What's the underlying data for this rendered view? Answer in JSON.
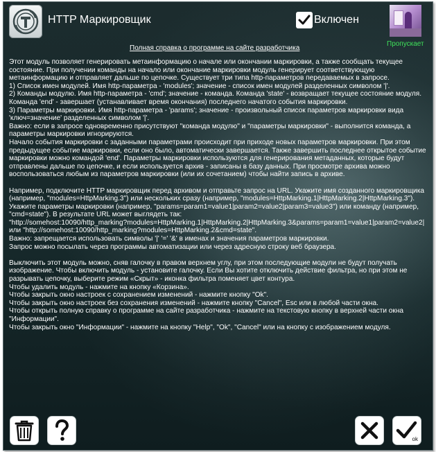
{
  "header": {
    "title": "HTTP Маркировщик",
    "enabled_label": "Включен",
    "enabled": true,
    "status": "Пропускает",
    "status_color": "#3fe05a",
    "help_link": "Полная справка о программе на сайте разработчика"
  },
  "body": {
    "paragraphs": [
      "Этот модуль позволяет генерировать метаинформацию о начале или окончании маркировки, а также сообщать текущее состояние. При получении команды на начало или окончание маркировки модуль генерирует соответствующую метаинформацию и отправляет дальше по цепочке. Существует три типа http-параметров передаваемых в запросе.\n1) Список имен модулей. Имя http-параметра - 'modules'; значение - список имен модулей разделенных символом '|'.\n2) Команды модулю. Имя http-параметра - 'cmd'; значение - команда. Команда 'state' - возвращает текущее состояние модуля. Команда 'end' - завершает (устанавливает время окончания) последнего начатого события маркировки.\n3) Параметры маркировки. Имя http-параметра - 'params'; значение - произвольный список параметров маркировки вида 'ключ=значение' разделенных символом '|'.\nВажно: если в запросе одновременно присутствуют \"команда модулю\" и \"параметры маркировки\" - выполнится команда, а параметры маркировки игнорируются.\nНачало события маркировки с заданными параметрами происходит при приходе новых параметров маркировки. При этом предыдущее событие маркировки, если оно было, автоматически завершается. Также завершить последнее открытое событие маркировки можно командой 'end'. Параметры маркировки используются для генерирования метаданных, которые будут отправлены дальше по цепочке, и если используется архив - записаны в базу данных. При просмотре архива можно воспользоваться любым из параметров маркировки (или их сочетанием) чтобы найти запись в архиве.",
      "Например, подключите HTTP маркировщик перед архивом и отправьте запрос на URL. Укажите имя созданного маркировщика (например, \"modules=HttpMarking.3\") или нескольких сразу (например, \"modules=HttpMarking.1|HttpMarking.2|HttpMarking.3\"). Укажите параметры маркировки (например, \"params=param1=value1|param2=value2|param3=value3\") или команду (например, \"cmd=state\"). В результате URL может выглядеть так:\n\"http://somehost:10090/http_marking?modules=HttpMarking.1|HttpMarking.2|HttpMarking.3&params=param1=value1|param2=value2| или \"http://somehost:10090/http_marking?modules=HttpMarking.2&cmd=state\".\nВажно: запрещается использовать символы '|' '=' '&' в именах и значения параметров маркировки.\nЗапрос можно посылать через программы автоматизации или через адресную строку веб браузера.",
      "Выключить этот модуль можно, сняв галочку в правом верхнем углу, при этом последующие модули не будут получать изображение. Чтобы включить модуль - установите галочку. Если Вы хотите отключить действие фильтра, но при этом не разрывать цепочку, выберите режим «Скрыт» - иконка фильтра поменяет цвет контура.\nЧтобы удалить модуль - нажмите на кнопку «Корзина».\nЧтобы закрыть окно настроек с сохранением изменений - нажмите кнопку \"Ok\".\nЧтобы закрыть окно настроек без сохранения изменений - нажмите кнопку \"Cancel\", Esc или в любой части окна.\nЧтобы открыть полную справку о программе на сайте разработчика - нажмите на текстовую кнопку в верхней части окна \"Информации\".\nЧтобы закрыть окно \"Информации\" - нажмите на кнопку \"Help\", \"Ok\", \"Cancel\" или на кнопку с изображением модуля."
    ]
  },
  "footer": {
    "ok_label": "ok"
  },
  "icons": {
    "logo": "t-logo-icon",
    "enabled": "check-icon",
    "delete": "trash-icon",
    "help": "question-icon",
    "cancel": "close-icon",
    "ok": "check-icon"
  }
}
